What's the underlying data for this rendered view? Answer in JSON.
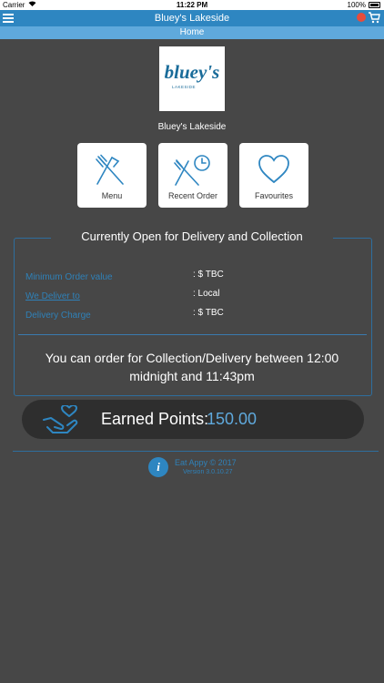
{
  "status_bar": {
    "carrier": "Carrier",
    "time": "11:22 PM",
    "battery": "100%"
  },
  "nav": {
    "title": "Bluey's Lakeside",
    "menu_icon": "hamburger-icon",
    "cart_icon": "cart-icon"
  },
  "subheader": {
    "label": "Home"
  },
  "logo": {
    "main": "bluey's",
    "sub": "LAKESIDE"
  },
  "restaurant_name": "Bluey's Lakeside",
  "tiles": [
    {
      "label": "Menu",
      "icon": "fork-knife-icon"
    },
    {
      "label": "Recent Order",
      "icon": "fork-knife-clock-icon"
    },
    {
      "label": "Favourites",
      "icon": "heart-icon"
    }
  ],
  "info": {
    "heading": "Currently Open for Delivery and Collection",
    "rows": [
      {
        "label": "Minimum Order value",
        "value": ": $ TBC"
      },
      {
        "label": "We Deliver to",
        "value": ": Local"
      },
      {
        "label": "Delivery Charge",
        "value": ": $ TBC"
      }
    ],
    "order_window": "You can order for Collection/Delivery between 12:00 midnight and 11:43pm"
  },
  "points": {
    "label": "Earned Points:",
    "value": "150.00",
    "icon": "hand-heart-icon"
  },
  "footer": {
    "copyright": "Eat Appy © 2017",
    "version": "Version 3.0.10.27"
  },
  "colors": {
    "accent": "#2e86c1",
    "background": "#474747",
    "label": "#2f81b8"
  }
}
